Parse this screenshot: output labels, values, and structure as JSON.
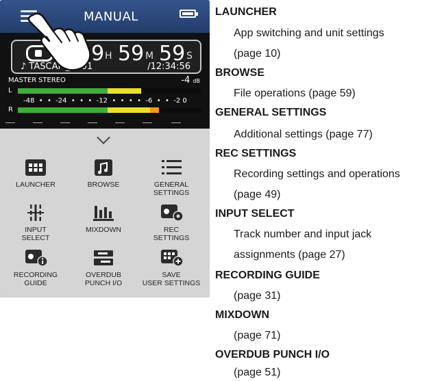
{
  "screen": {
    "title": "MANUAL",
    "counter": {
      "hours": "99",
      "hours_unit": "H",
      "minutes": "59",
      "minutes_unit": "M",
      "seconds": "59",
      "seconds_unit": "S",
      "file_name": "♪ TASCAM_0001",
      "remaining_time": "/12:34:56"
    },
    "meter": {
      "master_label": "MASTER",
      "mode_label": "STEREO",
      "level": "-4",
      "level_unit": "dB",
      "left_label": "L",
      "right_label": "R",
      "scale": "-48  •  •  -24  •  •  •  -12  •  •  •  •  -6  •  •  -2 0",
      "left_level": 0.67,
      "right_level": 0.77
    },
    "menu_items": [
      {
        "label": "LAUNCHER",
        "icon": "launcher-grid-icon"
      },
      {
        "label": "BROWSE",
        "icon": "music-note-folder-icon"
      },
      {
        "label": "GENERAL\nSETTINGS",
        "icon": "list-icon"
      },
      {
        "label": "INPUT\nSELECT",
        "icon": "input-routing-icon"
      },
      {
        "label": "MIXDOWN",
        "icon": "mixdown-icon"
      },
      {
        "label": "REC\nSETTINGS",
        "icon": "rec-gear-icon"
      },
      {
        "label": "RECORDING\nGUIDE",
        "icon": "recording-info-icon"
      },
      {
        "label": "OVERDUB\nPUNCH I/O",
        "icon": "overdub-icon"
      },
      {
        "label": "SAVE\nUSER SETTINGS",
        "icon": "save-plus-icon"
      }
    ]
  },
  "descriptions": [
    {
      "heading": "LAUNCHER",
      "lines": [
        "App switching and unit settings",
        "(page 10)"
      ]
    },
    {
      "heading": "BROWSE",
      "lines": [
        "File operations (page 59)"
      ]
    },
    {
      "heading": "GENERAL SETTINGS",
      "lines": [
        "Additional settings (page 77)"
      ]
    },
    {
      "heading": "REC SETTINGS",
      "lines": [
        "Recording settings and operations",
        "(page 49)"
      ]
    },
    {
      "heading": "INPUT SELECT",
      "lines": [
        "Track number and input jack",
        "assignments (page 27)"
      ]
    },
    {
      "heading": "RECORDING GUIDE",
      "lines": [
        "(page 31)"
      ]
    },
    {
      "heading": "MIXDOWN",
      "lines": [
        "(page 71)"
      ]
    },
    {
      "heading": "OVERDUB PUNCH I/O",
      "lines": [
        "(page 51)"
      ]
    }
  ],
  "colors": {
    "header_blue": "#2b4a7e",
    "meter_green": "#3fae3a",
    "meter_yellow": "#e8e02a",
    "meter_orange": "#f29a1c",
    "panel_gray": "#d5d5d5"
  }
}
